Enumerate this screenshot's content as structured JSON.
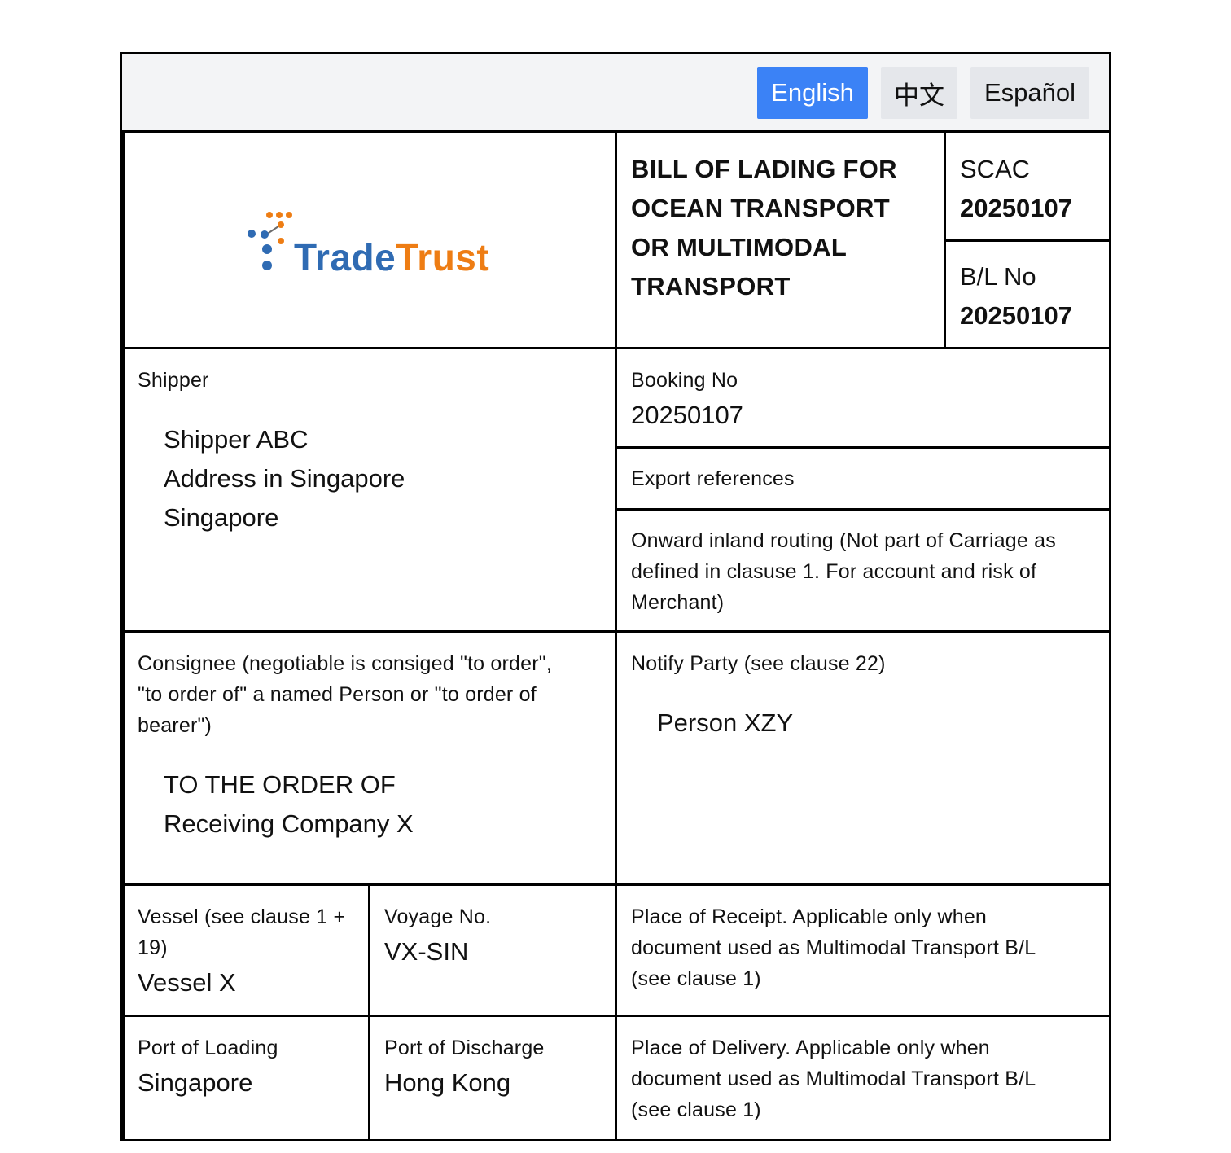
{
  "languages": [
    {
      "label": "English",
      "active": true
    },
    {
      "label": "中文",
      "active": false
    },
    {
      "label": "Español",
      "active": false
    }
  ],
  "logo": {
    "word1": "Trade",
    "word2": "Trust",
    "color1": "#2f6bb3",
    "color2": "#ee7d14"
  },
  "title_lines": [
    "BILL OF LADING FOR",
    "OCEAN TRANSPORT",
    "OR MULTIMODAL",
    "TRANSPORT"
  ],
  "scac": {
    "label": "SCAC",
    "value": "20250107"
  },
  "bl_no": {
    "label": "B/L No",
    "value": "20250107"
  },
  "shipper": {
    "label": "Shipper",
    "lines": [
      "Shipper ABC",
      "Address in Singapore",
      "Singapore"
    ]
  },
  "booking": {
    "label": "Booking No",
    "value": "20250107"
  },
  "export_references": {
    "label": "Export references"
  },
  "onward_routing": {
    "label_lines": [
      "Onward inland routing (Not part of Carriage as",
      "defined in clasuse 1. For account and risk of",
      "Merchant)"
    ]
  },
  "consignee": {
    "label_lines": [
      "Consignee (negotiable is consiged \"to order\",",
      "\"to order of\" a named Person or \"to order of",
      "bearer\")"
    ],
    "lines": [
      "TO THE ORDER OF",
      "Receiving Company X"
    ]
  },
  "notify_party": {
    "label": "Notify Party (see clause 22)",
    "value": "Person XZY"
  },
  "vessel": {
    "label_lines": [
      "Vessel (see clause 1 +",
      "19)"
    ],
    "value": "Vessel X"
  },
  "voyage": {
    "label": "Voyage No.",
    "value": "VX-SIN"
  },
  "place_of_receipt": {
    "label_lines": [
      "Place of Receipt. Applicable only when",
      "document used as Multimodal Transport B/L",
      "(see clause 1)"
    ]
  },
  "port_of_loading": {
    "label": "Port of Loading",
    "value": "Singapore"
  },
  "port_of_discharge": {
    "label": "Port of Discharge",
    "value": "Hong Kong"
  },
  "place_of_delivery": {
    "label_lines": [
      "Place of Delivery. Applicable only when",
      "document used as Multimodal Transport B/L",
      "(see clause 1)"
    ]
  }
}
